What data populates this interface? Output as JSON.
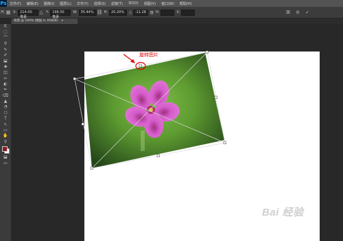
{
  "app": {
    "logo": "Ps"
  },
  "menu": {
    "items": [
      "文件(F)",
      "编辑(E)",
      "图像(I)",
      "图层(L)",
      "文字(Y)",
      "选择(S)",
      "滤镜(T)",
      "3D(D)",
      "视图(V)",
      "窗口(W)",
      "帮助(H)"
    ]
  },
  "options": {
    "x_label": "X:",
    "x_value": "214.00 像素",
    "y_label": "Y:",
    "y_value": "196.50 像素",
    "w_label": "W:",
    "w_value": "35.44%",
    "h_label": "H:",
    "h_value": "20.20%",
    "angle_label": "△",
    "angle_value": "-11.28",
    "interp_label": "度",
    "h_skew_label": "H:",
    "v_skew_label": "V:",
    "warp_icon": "warp-icon",
    "cancel_icon": "cancel-icon",
    "commit_icon": "check-icon"
  },
  "document": {
    "tab_label": "背景 @ 100% (图层 0, RGB/8)",
    "close": "×"
  },
  "tools": [
    "⇱",
    "⬚",
    "⌒",
    "⚲",
    "✎",
    "✐",
    "⬓",
    "✚",
    "◫",
    "✂",
    "◐",
    "✏",
    "⌫",
    "▲",
    "◔",
    "⬡",
    "T",
    "↖",
    "▭",
    "✋",
    "⚲",
    "◼",
    "⬓",
    "▭"
  ],
  "annotation": {
    "text": "旋转图片",
    "color": "#e00000"
  },
  "watermark": {
    "text": "Bai  经验"
  },
  "colors": {
    "petal": "#d04fc4",
    "leaf_dark": "#2f5a18",
    "leaf_light": "#8ec75a"
  }
}
